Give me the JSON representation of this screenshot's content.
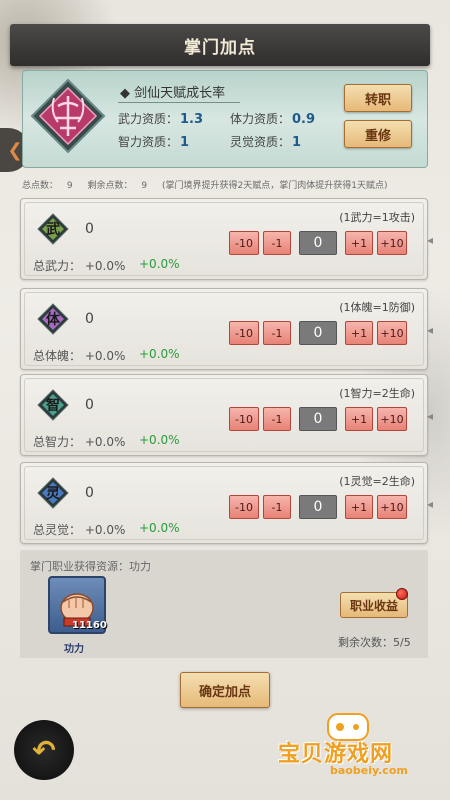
{
  "header": {
    "title": "掌门加点"
  },
  "talent": {
    "title": "◆ 剑仙天赋成长率",
    "stats": [
      {
        "label": "武力资质：",
        "value": "1.3"
      },
      {
        "label": "体力资质：",
        "value": "0.9"
      },
      {
        "label": "智力资质：",
        "value": "1"
      },
      {
        "label": "灵觉资质：",
        "value": "1"
      }
    ],
    "transfer_label": "转职",
    "reset_label": "重修"
  },
  "points": {
    "total_label": "总点数：",
    "total_value": "9",
    "remaining_label": "剩余点数：",
    "remaining_value": "9",
    "note": "(掌门境界提升获得2天赋点，掌门肉体提升获得1天赋点)"
  },
  "attributes": [
    {
      "glyph": "武",
      "value": "0",
      "rule": "(1武力=1攻击)",
      "total_label": "总武力：",
      "total_value": "+0.0%",
      "bonus": "+0.0%",
      "minus10": "-10",
      "minus1": "-1",
      "input": "0",
      "plus1": "+1",
      "plus10": "+10",
      "color": "#7aa14a"
    },
    {
      "glyph": "体",
      "value": "0",
      "rule": "(1体魄=1防御)",
      "total_label": "总体魄：",
      "total_value": "+0.0%",
      "bonus": "+0.0%",
      "minus10": "-10",
      "minus1": "-1",
      "input": "0",
      "plus1": "+1",
      "plus10": "+10",
      "color": "#a66ac0"
    },
    {
      "glyph": "智",
      "value": "0",
      "rule": "(1智力=2生命)",
      "total_label": "总智力：",
      "total_value": "+0.0%",
      "bonus": "+0.0%",
      "minus10": "-10",
      "minus1": "-1",
      "input": "0",
      "plus1": "+1",
      "plus10": "+10",
      "color": "#4aa08a"
    },
    {
      "glyph": "灵",
      "value": "0",
      "rule": "(1灵觉=2生命)",
      "total_label": "总灵觉：",
      "total_value": "+0.0%",
      "bonus": "+0.0%",
      "minus10": "-10",
      "minus1": "-1",
      "input": "0",
      "plus1": "+1",
      "plus10": "+10",
      "color": "#4a7ac0"
    }
  ],
  "resource": {
    "label": "掌门职业获得资源：功力",
    "item_count": "11160",
    "item_name": "功力",
    "income_label": "职业收益",
    "remaining_label": "剩余次数：5/5"
  },
  "confirm_label": "确定加点",
  "watermark": {
    "text": "宝贝游戏网",
    "url": "baobeiy.com"
  },
  "colors": {
    "gold_button": "#e6b978",
    "step_button": "#e88276",
    "bonus_green": "#2a9a3a",
    "talent_teal": "#c5dbd4"
  }
}
